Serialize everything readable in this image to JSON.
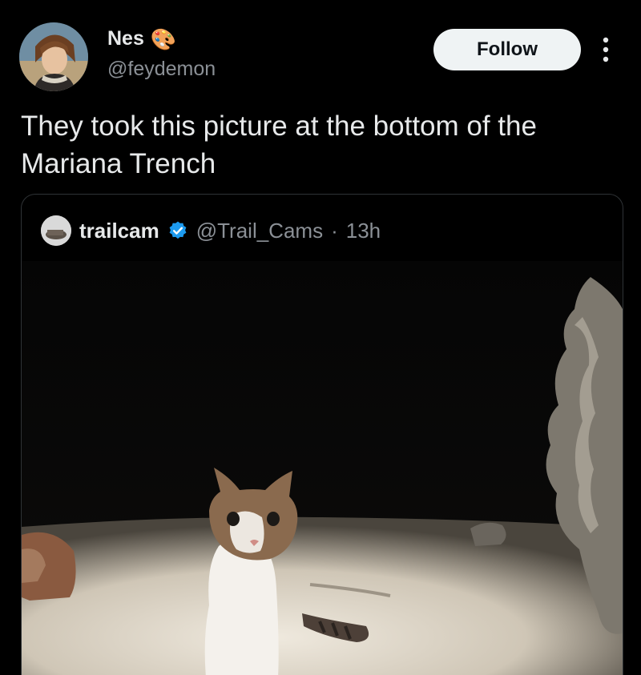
{
  "post": {
    "author_name": "Nes",
    "author_emoji": "🎨",
    "author_handle": "@feydemon",
    "follow_label": "Follow",
    "text": "They took this picture at the bottom of the Mariana Trench"
  },
  "quoted": {
    "author_name": "trailcam",
    "verified_icon": "verified-badge-icon",
    "author_handle": "@Trail_Cams",
    "separator": "·",
    "time": "13h"
  },
  "colors": {
    "background": "#000000",
    "follow_bg": "#eff3f4",
    "verified": "#1d9bf0",
    "muted_text": "#8b9096"
  }
}
